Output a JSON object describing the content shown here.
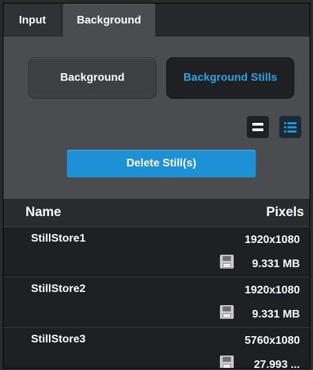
{
  "tabs": [
    {
      "label": "Input",
      "active": false
    },
    {
      "label": "Background",
      "active": true
    }
  ],
  "segments": {
    "background_label": "Background",
    "stills_label": "Background Stills",
    "selected": "Background Stills"
  },
  "view_toggle": {
    "list_icon": "list-view-icon",
    "details_icon": "details-view-icon",
    "selected": "details"
  },
  "delete_label": "Delete Still(s)",
  "table": {
    "columns": {
      "name": "Name",
      "pixels": "Pixels"
    },
    "rows": [
      {
        "name": "StillStore1",
        "pixels": "1920x1080",
        "size": "9.331 MB"
      },
      {
        "name": "StillStore2",
        "pixels": "1920x1080",
        "size": "9.331 MB"
      },
      {
        "name": "StillStore3",
        "pixels": "5760x1080",
        "size": "27.993 ..."
      }
    ]
  },
  "colors": {
    "accent": "#1e90d6",
    "selected_text": "#2aa3e4",
    "panel": "#4a4c4f",
    "list_bg": "#1e1f22"
  }
}
